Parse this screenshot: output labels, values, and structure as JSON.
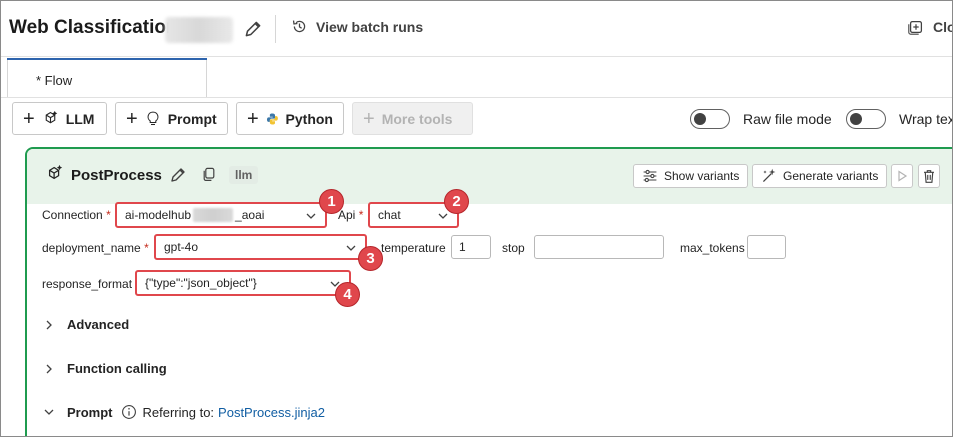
{
  "header": {
    "title": "Web Classification-",
    "view_batch_runs": "View batch runs",
    "clone_label": "Clo"
  },
  "tabs": [
    {
      "label": "* Flow"
    }
  ],
  "toolbar": {
    "llm": "LLM",
    "prompt": "Prompt",
    "python": "Python",
    "more_tools": "More tools",
    "raw_file_mode": "Raw file mode",
    "wrap_text": "Wrap tex"
  },
  "node": {
    "title": "PostProcess",
    "badge": "llm",
    "show_variants": "Show variants",
    "generate_variants": "Generate variants",
    "fields": {
      "connection": {
        "label": "Connection",
        "value_prefix": "ai-modelhub",
        "value_suffix": "_aoai"
      },
      "api": {
        "label": "Api",
        "value": "chat"
      },
      "deployment_name": {
        "label": "deployment_name",
        "value": "gpt-4o"
      },
      "temperature": {
        "label": "temperature",
        "value": "1"
      },
      "stop": {
        "label": "stop",
        "value": ""
      },
      "max_tokens": {
        "label": "max_tokens",
        "value": ""
      },
      "response_format": {
        "label": "response_format",
        "value": "{\"type\":\"json_object\"}"
      }
    },
    "sections": {
      "advanced": "Advanced",
      "function_calling": "Function calling",
      "prompt": "Prompt",
      "referring_to": "Referring to:",
      "prompt_file": "PostProcess.jinja2"
    }
  },
  "callouts": [
    "1",
    "2",
    "3",
    "4"
  ],
  "colors": {
    "accent_green": "#1f9b4f",
    "callout_red": "#e0474c",
    "link_blue": "#115ea3"
  }
}
